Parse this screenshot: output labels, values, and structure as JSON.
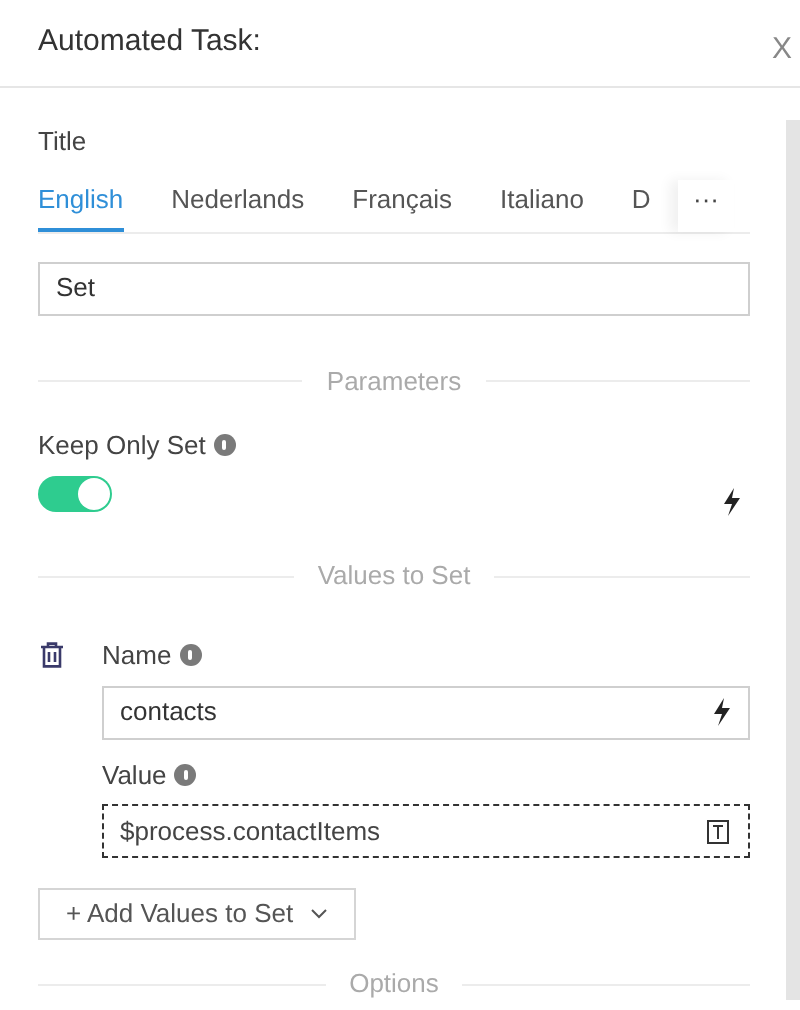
{
  "header": {
    "title": "Automated Task:",
    "close": "X"
  },
  "title_field": {
    "label": "Title",
    "value": "Set"
  },
  "tabs": [
    {
      "label": "English",
      "selected": true
    },
    {
      "label": "Nederlands",
      "selected": false
    },
    {
      "label": "Français",
      "selected": false
    },
    {
      "label": "Italiano",
      "selected": false
    },
    {
      "label": "D",
      "selected": false
    }
  ],
  "tabs_more": "···",
  "sections": [
    "Parameters",
    "Values to Set",
    "Options"
  ],
  "keep_only_set": {
    "label": "Keep Only Set",
    "on": true
  },
  "values": [
    {
      "name_label": "Name",
      "name": "contacts",
      "value_label": "Value",
      "value": "$process.contactItems"
    }
  ],
  "add_button": "+ Add Values to Set"
}
